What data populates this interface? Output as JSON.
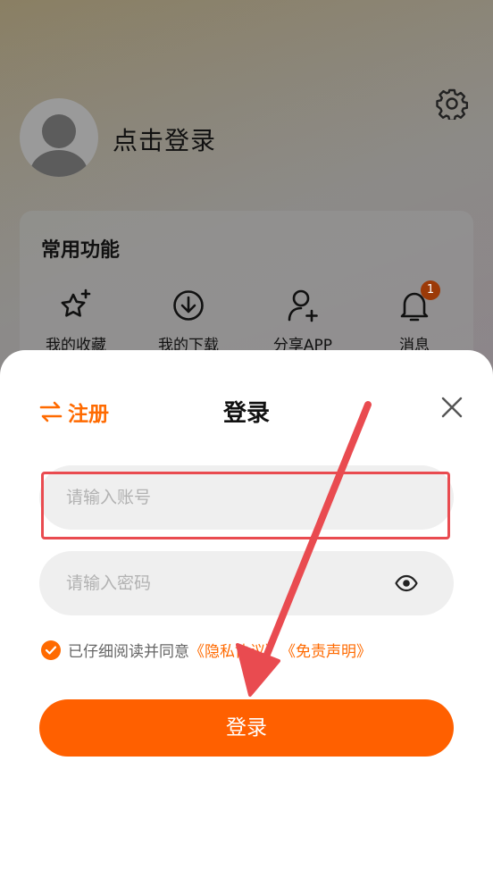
{
  "profile": {
    "login_hint": "点击登录"
  },
  "common_functions": {
    "title": "常用功能",
    "items": [
      {
        "label": "我的收藏",
        "icon": "star-sparkle-icon"
      },
      {
        "label": "我的下载",
        "icon": "download-icon"
      },
      {
        "label": "分享APP",
        "icon": "user-add-icon"
      },
      {
        "label": "消息",
        "icon": "bell-icon",
        "badge": "1"
      }
    ]
  },
  "login_sheet": {
    "register_label": "注册",
    "title": "登录",
    "account_placeholder": "请输入账号",
    "password_placeholder": "请输入密码",
    "agree_text": "已仔细阅读并同意",
    "privacy_link": "《隐私协议》",
    "disclaimer_link": "《免责声明》",
    "login_button": "登录"
  },
  "colors": {
    "accent": "#ff6a00",
    "button": "#ff6000",
    "highlight_box": "#e94b50",
    "arrow": "#e94b50"
  }
}
